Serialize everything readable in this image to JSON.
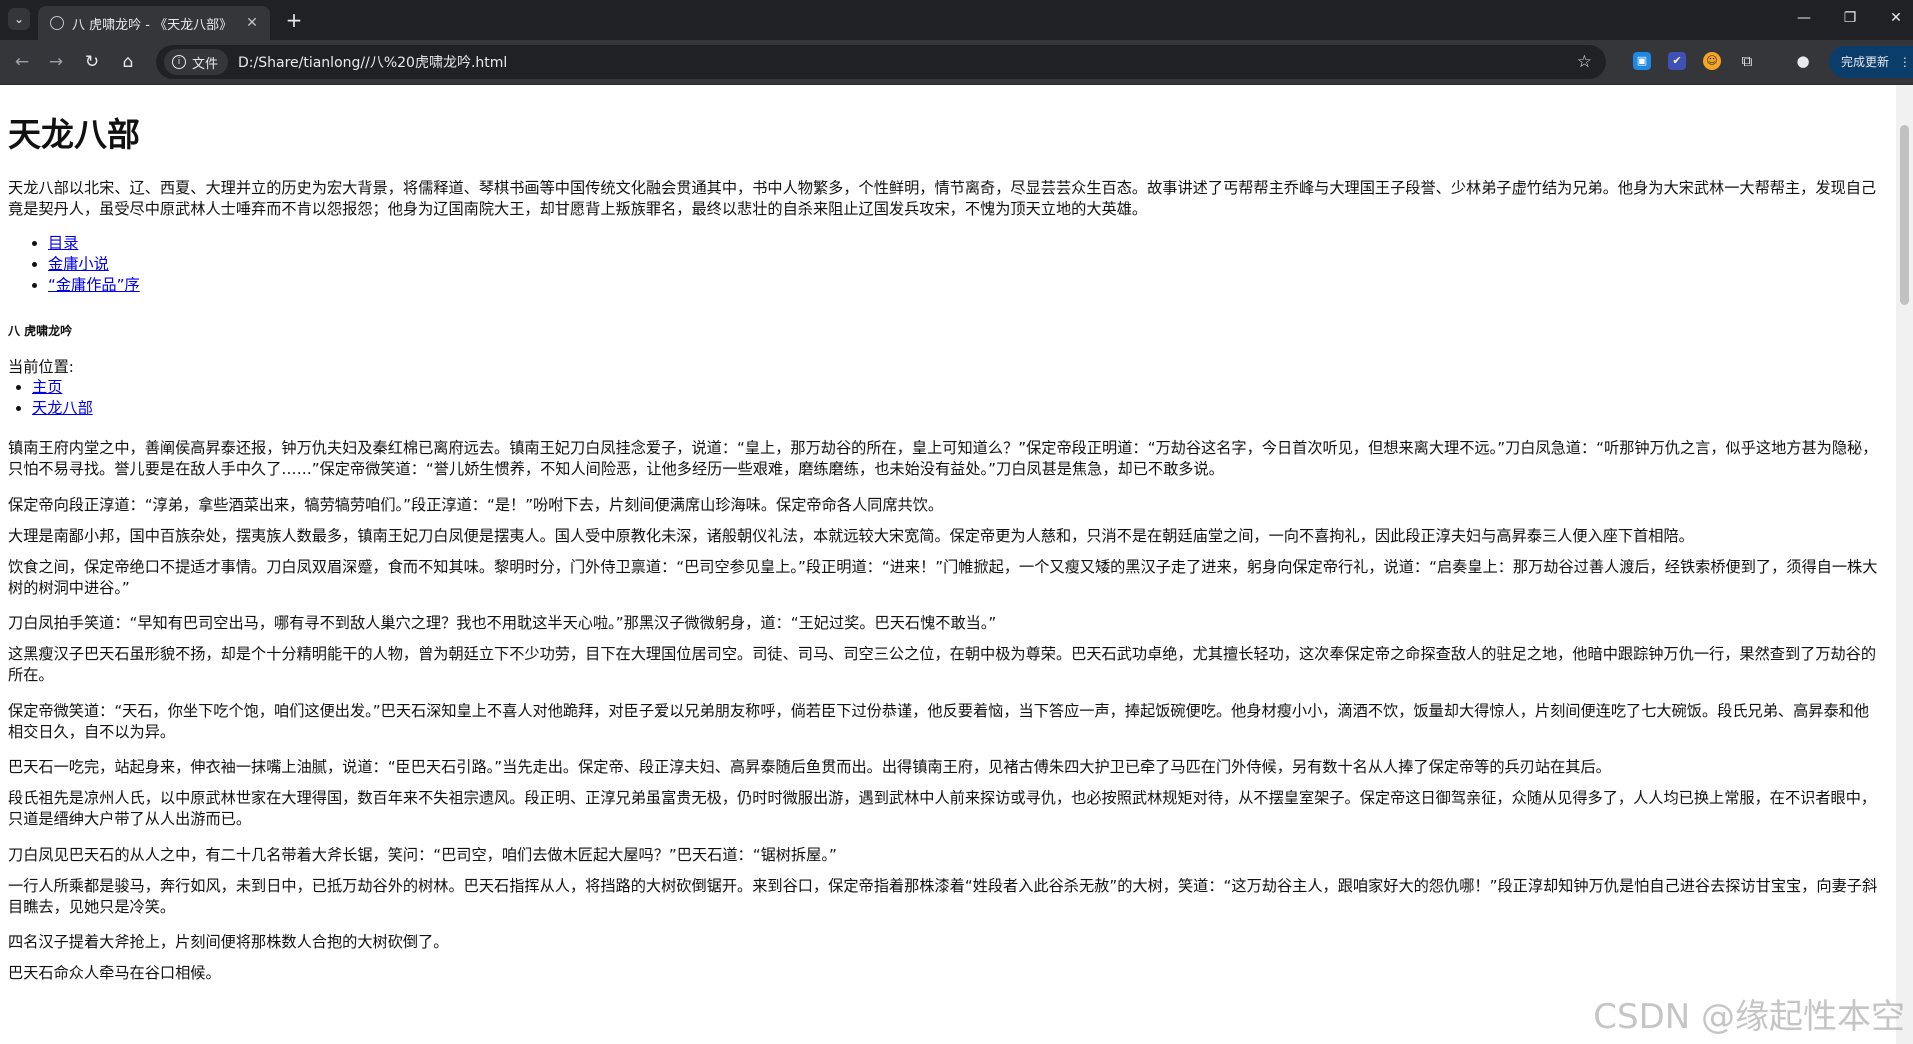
{
  "browser": {
    "tab_title": "八 虎啸龙吟 - 《天龙八部》",
    "new_tab_symbol": "+",
    "security_chip": "文件",
    "url": "D:/Share/tianlong//八%20虎啸龙吟.html",
    "update_button": "完成更新"
  },
  "page": {
    "title": "天龙八部",
    "intro": "天龙八部以北宋、辽、西夏、大理并立的历史为宏大背景，将儒释道、琴棋书画等中国传统文化融会贯通其中，书中人物繁多，个性鲜明，情节离奇，尽显芸芸众生百态。故事讲述了丐帮帮主乔峰与大理国王子段誉、少林弟子虚竹结为兄弟。他身为大宋武林一大帮帮主，发现自己竟是契丹人，虽受尽中原武林人士唾弃而不肯以怨报怨；他身为辽国南院大王，却甘愿背上叛族罪名，最终以悲壮的自杀来阻止辽国发兵攻宋，不愧为顶天立地的大英雄。",
    "toc_links": [
      "目录",
      "金庸小说",
      "“金庸作品”序"
    ],
    "chapter_heading": "八 虎啸龙吟",
    "crumb_label": "当前位置:",
    "crumbs": [
      "主页",
      "天龙八部"
    ],
    "paragraphs": [
      "镇南王府内堂之中，善阐侯高昇泰还报，钟万仇夫妇及秦红棉已离府远去。镇南王妃刀白凤挂念爱子，说道：“皇上，那万劫谷的所在，皇上可知道么？”保定帝段正明道：“万劫谷这名字，今日首次听见，但想来离大理不远。”刀白凤急道：“听那钟万仇之言，似乎这地方甚为隐秘，只怕不易寻找。誉儿要是在敌人手中久了……”保定帝微笑道：“誉儿娇生惯养，不知人间险恶，让他多经历一些艰难，磨练磨练，也未始没有益处。”刀白凤甚是焦急，却已不敢多说。",
      "保定帝向段正淳道：“淳弟，拿些酒菜出来，犒劳犒劳咱们。”段正淳道：“是！”吩咐下去，片刻间便满席山珍海味。保定帝命各人同席共饮。",
      "大理是南鄙小邦，国中百族杂处，摆夷族人数最多，镇南王妃刀白凤便是摆夷人。国人受中原教化未深，诸般朝仪礼法，本就远较大宋宽简。保定帝更为人慈和，只消不是在朝廷庙堂之间，一向不喜拘礼，因此段正淳夫妇与高昇泰三人便入座下首相陪。",
      "饮食之间，保定帝绝口不提适才事情。刀白凤双眉深蹙，食而不知其味。黎明时分，门外侍卫禀道：“巴司空参见皇上。”段正明道：“进来！”门帷掀起，一个又瘦又矮的黑汉子走了进来，躬身向保定帝行礼，说道：“启奏皇上：那万劫谷过善人渡后，经铁索桥便到了，须得自一株大树的树洞中进谷。”",
      "刀白凤拍手笑道：“早知有巴司空出马，哪有寻不到敌人巢穴之理？我也不用耽这半天心啦。”那黑汉子微微躬身，道：“王妃过奖。巴天石愧不敢当。”",
      "这黑瘦汉子巴天石虽形貌不扬，却是个十分精明能干的人物，曾为朝廷立下不少功劳，目下在大理国位居司空。司徒、司马、司空三公之位，在朝中极为尊荣。巴天石武功卓绝，尤其擅长轻功，这次奉保定帝之命探查敌人的驻足之地，他暗中跟踪钟万仇一行，果然查到了万劫谷的所在。",
      "保定帝微笑道：“天石，你坐下吃个饱，咱们这便出发。”巴天石深知皇上不喜人对他跪拜，对臣子爱以兄弟朋友称呼，倘若臣下过份恭谨，他反要着恼，当下答应一声，捧起饭碗便吃。他身材瘦小小，滴酒不饮，饭量却大得惊人，片刻间便连吃了七大碗饭。段氏兄弟、高昇泰和他相交日久，自不以为异。",
      "巴天石一吃完，站起身来，伸衣袖一抹嘴上油腻，说道：“臣巴天石引路。”当先走出。保定帝、段正淳夫妇、高昇泰随后鱼贯而出。出得镇南王府，见褚古傅朱四大护卫已牵了马匹在门外侍候，另有数十名从人捧了保定帝等的兵刃站在其后。",
      "段氏祖先是凉州人氏，以中原武林世家在大理得国，数百年来不失祖宗遗风。段正明、正淳兄弟虽富贵无极，仍时时微服出游，遇到武林中人前来探访或寻仇，也必按照武林规矩对待，从不摆皇室架子。保定帝这日御驾亲征，众随从见得多了，人人均已换上常服，在不识者眼中，只道是缙绅大户带了从人出游而已。",
      "刀白凤见巴天石的从人之中，有二十几名带着大斧长锯，笑问：“巴司空，咱们去做木匠起大屋吗？”巴天石道：“锯树拆屋。”",
      "一行人所乘都是骏马，奔行如风，未到日中，已抵万劫谷外的树林。巴天石指挥从人，将挡路的大树砍倒锯开。来到谷口，保定帝指着那株漆着“姓段者入此谷杀无赦”的大树，笑道：“这万劫谷主人，跟咱家好大的怨仇哪！”段正淳却知钟万仇是怕自己进谷去探访甘宝宝，向妻子斜目瞧去，见她只是冷笑。",
      "四名汉子提着大斧抢上，片刻间便将那株数人合抱的大树砍倒了。",
      "巴天石命众人牵马在谷口相候。"
    ],
    "watermark": "CSDN @缘起性本空"
  }
}
